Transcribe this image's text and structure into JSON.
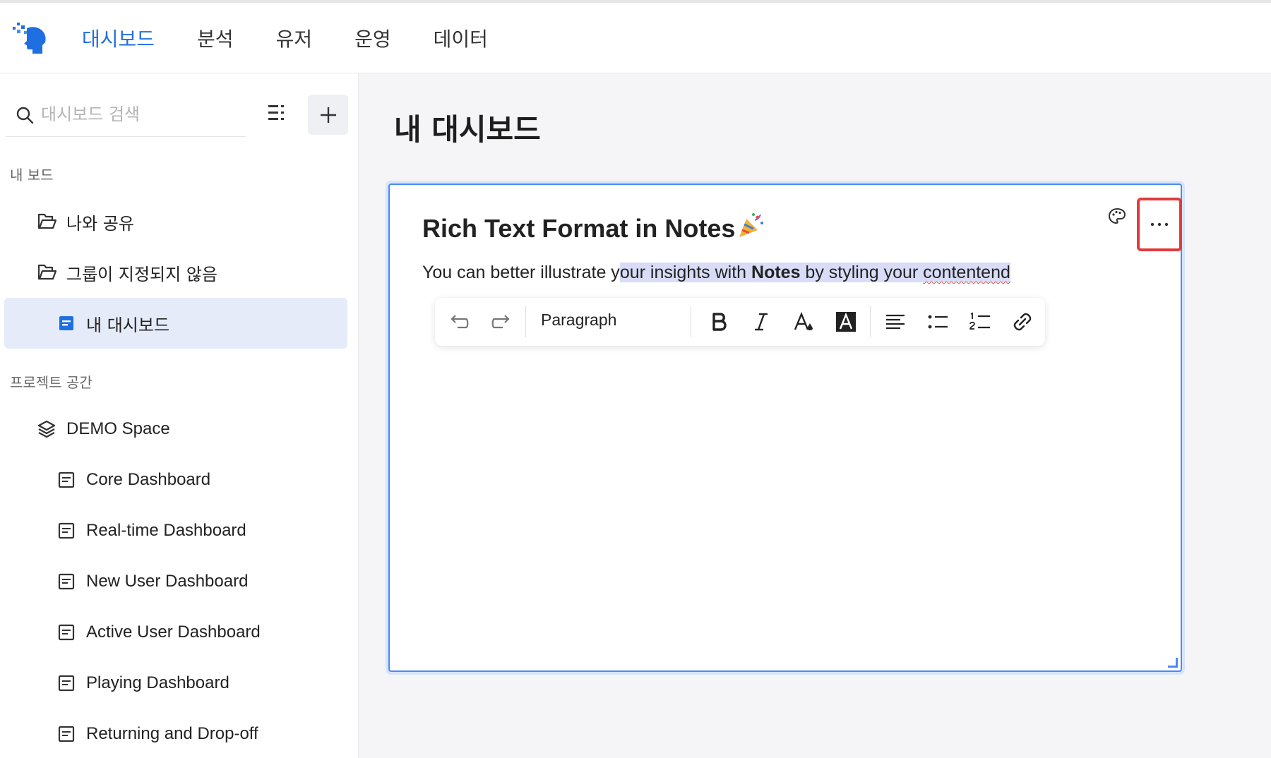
{
  "nav": {
    "items": [
      {
        "label": "대시보드",
        "active": true
      },
      {
        "label": "분석",
        "active": false
      },
      {
        "label": "유저",
        "active": false
      },
      {
        "label": "운영",
        "active": false
      },
      {
        "label": "데이터",
        "active": false
      }
    ]
  },
  "sidebar": {
    "search": {
      "placeholder": "대시보드 검색",
      "value": ""
    },
    "sections": [
      {
        "label": "내 보드"
      },
      {
        "label": "프로젝트 공간"
      }
    ],
    "my_boards": [
      {
        "label": "나와 공유",
        "icon": "folder-icon"
      },
      {
        "label": "그룹이 지정되지 않음",
        "icon": "folder-icon"
      },
      {
        "label": "내 대시보드",
        "icon": "dashboard-icon",
        "selected": true
      }
    ],
    "project": {
      "space": {
        "label": "DEMO Space",
        "icon": "layers-icon"
      },
      "dashboards": [
        {
          "label": "Core Dashboard"
        },
        {
          "label": "Real-time Dashboard"
        },
        {
          "label": "New User Dashboard"
        },
        {
          "label": "Active User Dashboard"
        },
        {
          "label": "Playing Dashboard"
        },
        {
          "label": "Returning and Drop-off"
        }
      ]
    }
  },
  "main": {
    "title": "내 대시보드",
    "note": {
      "title": "Rich Text Format in Notes",
      "title_emoji": "party-popper-icon",
      "text_before": "You can better illustrate y",
      "text_hl_1": "our insights with ",
      "text_bold": "Notes",
      "text_hl_2": " by styling your ",
      "text_wavy": "contentend",
      "toolbar": {
        "block_style": "Paragraph"
      }
    }
  },
  "colors": {
    "accent": "#1f6fe0",
    "highlight_box": "#e23b3b",
    "selection": "#d8dcf7"
  }
}
